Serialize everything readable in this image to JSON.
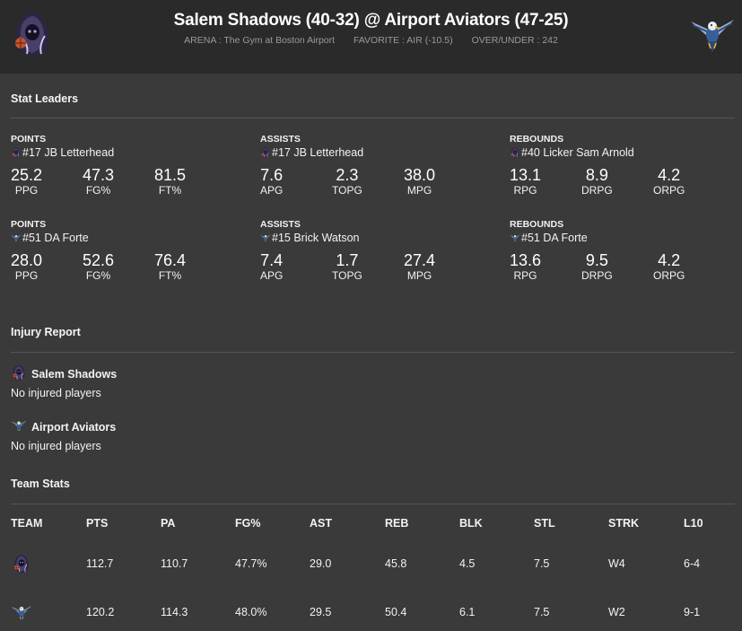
{
  "header": {
    "title": "Salem Shadows (40-32) @ Airport Aviators (47-25)",
    "arena": "ARENA : The Gym at Boston Airport",
    "favorite": "FAVORITE : AIR (-10.5)",
    "over_under": "OVER/UNDER : 242",
    "away_logo_icon": "reaper-basketball-icon",
    "home_logo_icon": "aviator-bird-icon"
  },
  "stat_leaders": {
    "title": "Stat Leaders",
    "rows": [
      [
        {
          "category": "POINTS",
          "team_icon": "reaper-basketball-icon",
          "player": "#17 JB Letterhead",
          "stats": [
            {
              "value": "25.2",
              "label": "PPG"
            },
            {
              "value": "47.3",
              "label": "FG%"
            },
            {
              "value": "81.5",
              "label": "FT%"
            }
          ]
        },
        {
          "category": "ASSISTS",
          "team_icon": "reaper-basketball-icon",
          "player": "#17 JB Letterhead",
          "stats": [
            {
              "value": "7.6",
              "label": "APG"
            },
            {
              "value": "2.3",
              "label": "TOPG"
            },
            {
              "value": "38.0",
              "label": "MPG"
            }
          ]
        },
        {
          "category": "REBOUNDS",
          "team_icon": "reaper-basketball-icon",
          "player": "#40 Licker Sam Arnold",
          "stats": [
            {
              "value": "13.1",
              "label": "RPG"
            },
            {
              "value": "8.9",
              "label": "DRPG"
            },
            {
              "value": "4.2",
              "label": "ORPG"
            }
          ]
        }
      ],
      [
        {
          "category": "POINTS",
          "team_icon": "aviator-bird-icon",
          "player": "#51 DA Forte",
          "stats": [
            {
              "value": "28.0",
              "label": "PPG"
            },
            {
              "value": "52.6",
              "label": "FG%"
            },
            {
              "value": "76.4",
              "label": "FT%"
            }
          ]
        },
        {
          "category": "ASSISTS",
          "team_icon": "aviator-bird-icon",
          "player": "#15 Brick Watson",
          "stats": [
            {
              "value": "7.4",
              "label": "APG"
            },
            {
              "value": "1.7",
              "label": "TOPG"
            },
            {
              "value": "27.4",
              "label": "MPG"
            }
          ]
        },
        {
          "category": "REBOUNDS",
          "team_icon": "aviator-bird-icon",
          "player": "#51 DA Forte",
          "stats": [
            {
              "value": "13.6",
              "label": "RPG"
            },
            {
              "value": "9.5",
              "label": "DRPG"
            },
            {
              "value": "4.2",
              "label": "ORPG"
            }
          ]
        }
      ]
    ]
  },
  "injury_report": {
    "title": "Injury Report",
    "teams": [
      {
        "name": "Salem Shadows",
        "icon": "reaper-basketball-icon",
        "note": "No injured players"
      },
      {
        "name": "Airport Aviators",
        "icon": "aviator-bird-icon",
        "note": "No injured players"
      }
    ]
  },
  "team_stats": {
    "title": "Team Stats",
    "columns": [
      "TEAM",
      "PTS",
      "PA",
      "FG%",
      "AST",
      "REB",
      "BLK",
      "STL",
      "STRK",
      "L10"
    ],
    "rows": [
      {
        "team_icon": "reaper-basketball-icon",
        "values": [
          "112.7",
          "110.7",
          "47.7%",
          "29.0",
          "45.8",
          "4.5",
          "7.5",
          "W4",
          "6-4"
        ]
      },
      {
        "team_icon": "aviator-bird-icon",
        "values": [
          "120.2",
          "114.3",
          "48.0%",
          "29.5",
          "50.4",
          "6.1",
          "7.5",
          "W2",
          "9-1"
        ]
      }
    ]
  },
  "colors": {
    "page_bg": "#3a3a3a",
    "header_bg": "#2a2a2a",
    "divider": "#555555",
    "muted_text": "#9a9a9a"
  }
}
